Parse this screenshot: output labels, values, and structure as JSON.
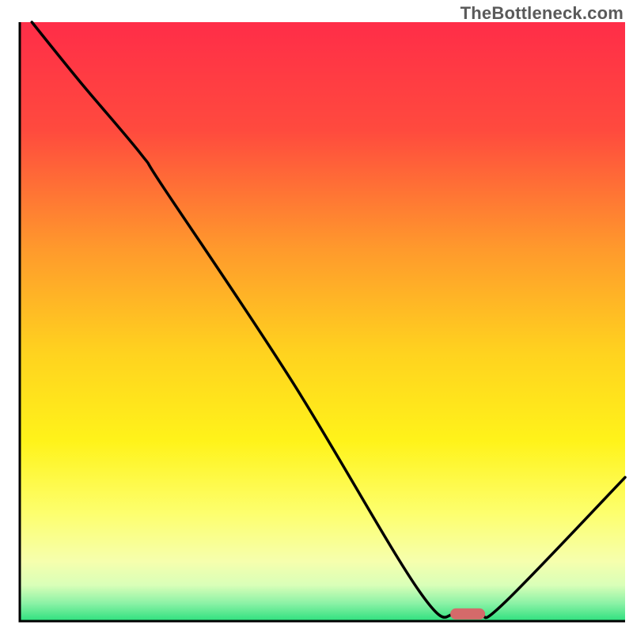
{
  "watermark": "TheBottleneck.com",
  "chart_data": {
    "type": "line",
    "title": "",
    "xlabel": "",
    "ylabel": "",
    "xlim": [
      0,
      100
    ],
    "ylim": [
      0,
      100
    ],
    "grid": false,
    "legend": false,
    "gradient_stops": [
      {
        "offset": 0.0,
        "color": "#ff2d48"
      },
      {
        "offset": 0.18,
        "color": "#ff4a3e"
      },
      {
        "offset": 0.38,
        "color": "#ff9a2c"
      },
      {
        "offset": 0.55,
        "color": "#ffd21f"
      },
      {
        "offset": 0.7,
        "color": "#fff31a"
      },
      {
        "offset": 0.82,
        "color": "#fdff6e"
      },
      {
        "offset": 0.9,
        "color": "#f6ffad"
      },
      {
        "offset": 0.94,
        "color": "#d9ffb8"
      },
      {
        "offset": 0.97,
        "color": "#8cf2a6"
      },
      {
        "offset": 1.0,
        "color": "#2de07e"
      }
    ],
    "series": [
      {
        "name": "bottleneck-curve",
        "x": [
          2,
          10,
          20,
          24,
          45,
          66,
          72,
          76,
          80,
          100
        ],
        "values": [
          100,
          90,
          78,
          72,
          40,
          5,
          1,
          1,
          3,
          24
        ]
      }
    ],
    "marker": {
      "name": "optimal-marker",
      "x": 74,
      "y": 1.2,
      "color": "#d46a6a"
    }
  }
}
